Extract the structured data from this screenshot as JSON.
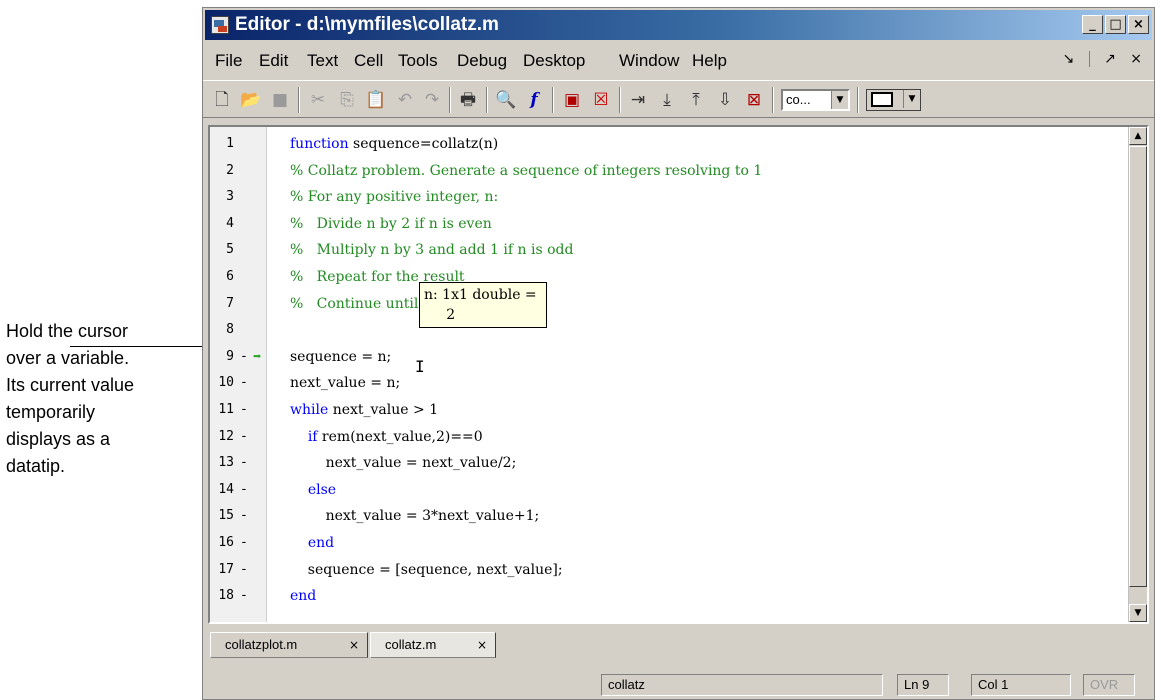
{
  "callout": {
    "text": "Hold the cursor\nover a variable.\nIts current value\ntemporarily\ndisplays as a\ndatatip."
  },
  "window": {
    "title": "Editor - d:\\mymfiles\\collatz.m",
    "buttons": {
      "minimize": "_",
      "maximize": "□",
      "close": "×"
    }
  },
  "menu": {
    "items": [
      "File",
      "Edit",
      "Text",
      "Cell",
      "Tools",
      "Debug",
      "Desktop",
      "Window",
      "Help"
    ],
    "undock": "↘",
    "maximize": "↗",
    "close": "×"
  },
  "toolbar": {
    "combo_value": "co...",
    "layout_combo_value": "",
    "icons": [
      "new-file-icon",
      "open-file-icon",
      "save-icon",
      "cut-icon",
      "copy-icon",
      "paste-icon",
      "undo-icon",
      "redo-icon",
      "print-icon",
      "find-icon",
      "function-icon",
      "set-breakpoint-icon",
      "clear-breakpoint-icon",
      "step-icon",
      "step-in-icon",
      "step-out-icon",
      "continue-icon",
      "exit-debug-icon"
    ]
  },
  "editor": {
    "lines": [
      {
        "n": "1",
        "dash": "",
        "code": [
          {
            "t": "function",
            "c": "kw"
          },
          {
            "t": " sequence=collatz(n)",
            "c": ""
          }
        ]
      },
      {
        "n": "2",
        "dash": "",
        "code": [
          {
            "t": "% Collatz problem. Generate a sequence of integers resolving to 1",
            "c": "cm"
          }
        ]
      },
      {
        "n": "3",
        "dash": "",
        "code": [
          {
            "t": "% For any positive integer, n:",
            "c": "cm"
          }
        ]
      },
      {
        "n": "4",
        "dash": "",
        "code": [
          {
            "t": "%   Divide n by 2 if n is even",
            "c": "cm"
          }
        ]
      },
      {
        "n": "5",
        "dash": "",
        "code": [
          {
            "t": "%   Multiply n by 3 and add 1 if n is odd",
            "c": "cm"
          }
        ]
      },
      {
        "n": "6",
        "dash": "",
        "code": [
          {
            "t": "%   Repeat for the result",
            "c": "cm"
          }
        ]
      },
      {
        "n": "7",
        "dash": "",
        "code": [
          {
            "t": "%   Continue until the result is 1%",
            "c": "cm"
          }
        ]
      },
      {
        "n": "8",
        "dash": "",
        "code": []
      },
      {
        "n": "9",
        "dash": "-",
        "arrow": true,
        "code": [
          {
            "t": "sequence = n;",
            "c": ""
          }
        ]
      },
      {
        "n": "10",
        "dash": "-",
        "code": [
          {
            "t": "next_value = n;",
            "c": ""
          }
        ]
      },
      {
        "n": "11",
        "dash": "-",
        "code": [
          {
            "t": "while",
            "c": "kw"
          },
          {
            "t": " next_value > 1",
            "c": ""
          }
        ]
      },
      {
        "n": "12",
        "dash": "-",
        "code": [
          {
            "t": "    ",
            "c": ""
          },
          {
            "t": "if",
            "c": "kw"
          },
          {
            "t": " rem(next_value,2)==0",
            "c": ""
          }
        ]
      },
      {
        "n": "13",
        "dash": "-",
        "code": [
          {
            "t": "        next_value = next_value/2;",
            "c": ""
          }
        ]
      },
      {
        "n": "14",
        "dash": "-",
        "code": [
          {
            "t": "    ",
            "c": ""
          },
          {
            "t": "else",
            "c": "kw"
          }
        ]
      },
      {
        "n": "15",
        "dash": "-",
        "code": [
          {
            "t": "        next_value = 3*next_value+1;",
            "c": ""
          }
        ]
      },
      {
        "n": "16",
        "dash": "-",
        "code": [
          {
            "t": "    ",
            "c": ""
          },
          {
            "t": "end",
            "c": "kw"
          }
        ]
      },
      {
        "n": "17",
        "dash": "-",
        "code": [
          {
            "t": "    sequence = [sequence, next_value];",
            "c": ""
          }
        ]
      },
      {
        "n": "18",
        "dash": "-",
        "code": [
          {
            "t": "end",
            "c": "kw"
          }
        ]
      }
    ],
    "datatip": {
      "line1": "n: 1x1 double =",
      "line2": "     2"
    }
  },
  "tabs": [
    {
      "label": "collatzplot.m",
      "close": "×",
      "active": false
    },
    {
      "label": "collatz.m",
      "close": "×",
      "active": true
    }
  ],
  "statusbar": {
    "function": "collatz",
    "line_label": "Ln  9",
    "col_label": "Col  1",
    "ovr": "OVR"
  },
  "colors": {
    "keyword": "#0000ff",
    "comment": "#228b22",
    "exec_arrow": "#28a428",
    "datatip_bg": "#ffffe1",
    "title_gradient_start": "#0a246a"
  }
}
